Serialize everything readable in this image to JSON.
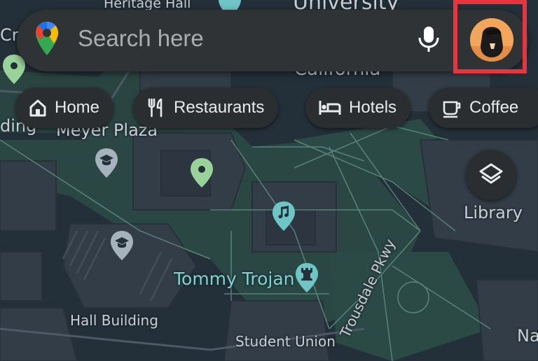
{
  "search": {
    "placeholder": "Search here"
  },
  "chips": [
    {
      "label": "Home",
      "icon": "home-icon"
    },
    {
      "label": "Restaurants",
      "icon": "restaurant-icon"
    },
    {
      "label": "Hotels",
      "icon": "hotel-bed-icon"
    },
    {
      "label": "Coffee",
      "icon": "coffee-cup-icon"
    }
  ],
  "map": {
    "labels": {
      "heritage_hall": "Heritage Hall",
      "university": "University",
      "california": "California",
      "meyer_plaza": "Meyer Plaza",
      "building_left": "ding",
      "cr_left": "Cr",
      "library": "Library",
      "tommy_trojan": "Tommy Trojan",
      "trousdale": "Trousdale Pkwy",
      "hall_building": "Hall Building",
      "student_union": "Student Union",
      "na_right": "Na"
    }
  },
  "colors": {
    "map_background": "#243039",
    "green_space": "#2c4a45",
    "search_bar": "#303335",
    "highlight_box": "#e7343f",
    "pin_teal": "#6fc5c6",
    "pin_green": "#9ad39a",
    "pin_gray": "#a6b2bc"
  }
}
